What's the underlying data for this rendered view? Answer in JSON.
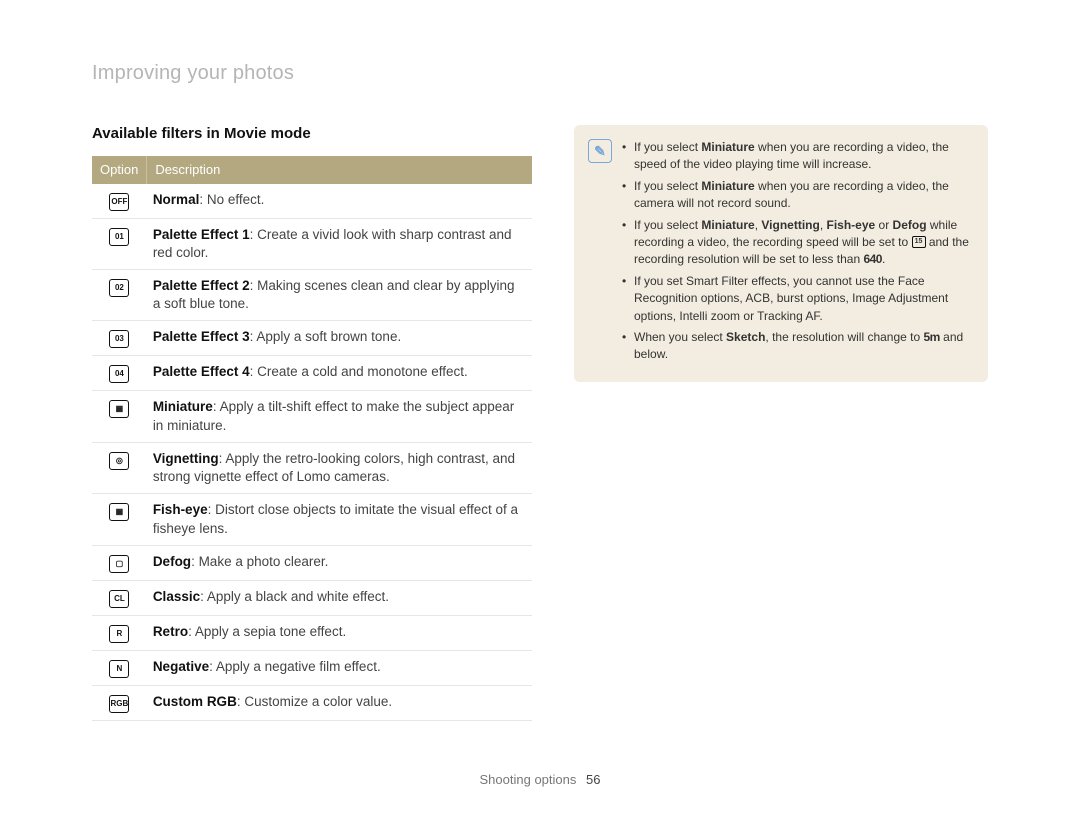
{
  "breadcrumb": "Improving your photos",
  "subheading": "Available filters in Movie mode",
  "table": {
    "headers": {
      "option": "Option",
      "description": "Description"
    },
    "rows": [
      {
        "icon": "OFF",
        "icon_name": "filter-off-icon",
        "name": "Normal",
        "desc": "No effect."
      },
      {
        "icon": "01",
        "icon_name": "palette-01-icon",
        "name": "Palette Effect 1",
        "desc": "Create a vivid look with sharp contrast and red color."
      },
      {
        "icon": "02",
        "icon_name": "palette-02-icon",
        "name": "Palette Effect 2",
        "desc": "Making scenes clean and clear by applying a soft blue tone."
      },
      {
        "icon": "03",
        "icon_name": "palette-03-icon",
        "name": "Palette Effect 3",
        "desc": "Apply a soft brown tone."
      },
      {
        "icon": "04",
        "icon_name": "palette-04-icon",
        "name": "Palette Effect 4",
        "desc": "Create a cold and monotone effect."
      },
      {
        "icon": "▦",
        "icon_name": "miniature-icon",
        "name": "Miniature",
        "desc": "Apply a tilt-shift effect to make the subject appear in miniature."
      },
      {
        "icon": "◎",
        "icon_name": "vignetting-icon",
        "name": "Vignetting",
        "desc": "Apply the retro-looking colors, high contrast, and strong vignette effect of Lomo cameras."
      },
      {
        "icon": "▦",
        "icon_name": "fisheye-icon",
        "name": "Fish-eye",
        "desc": "Distort close objects to imitate the visual effect of a fisheye lens."
      },
      {
        "icon": "▢",
        "icon_name": "defog-icon",
        "name": "Defog",
        "desc": "Make a photo clearer."
      },
      {
        "icon": "CL",
        "icon_name": "classic-icon",
        "name": "Classic",
        "desc": "Apply a black and white effect."
      },
      {
        "icon": "R",
        "icon_name": "retro-icon",
        "name": "Retro",
        "desc": "Apply a sepia tone effect."
      },
      {
        "icon": "N",
        "icon_name": "negative-icon",
        "name": "Negative",
        "desc": "Apply a negative film effect."
      },
      {
        "icon": "RGB",
        "icon_name": "custom-rgb-icon",
        "name": "Custom RGB",
        "desc": "Customize a color value."
      }
    ]
  },
  "notes": [
    {
      "pre": "If you select ",
      "bold1": "Miniature",
      "post": " when you are recording a video, the speed of the video playing time will increase."
    },
    {
      "pre": "If you select ",
      "bold1": "Miniature",
      "post": " when you are recording a video, the camera will not record sound."
    },
    {
      "pre": "If you select ",
      "bold1": "Miniature",
      "sep1": ", ",
      "bold2": "Vignetting",
      "sep2": ", ",
      "bold3": "Fish-eye",
      "sep3": " or ",
      "bold4": "Defog",
      "mid": " while recording a video, the recording speed will be set to ",
      "glyph1_name": "fps-15-icon",
      "glyph1": "15",
      "mid2": " and the recording resolution will be set to less than ",
      "glyph2": "640",
      "post": "."
    },
    {
      "pre": "If you set Smart Filter effects, you cannot use the Face Recognition options, ACB, burst options, Image Adjustment options, Intelli zoom or Tracking AF."
    },
    {
      "pre": "When you select ",
      "bold1": "Sketch",
      "mid": ", the resolution will change to ",
      "glyph1": "5m",
      "post": " and below."
    }
  ],
  "footer": {
    "section": "Shooting options",
    "page": "56"
  }
}
